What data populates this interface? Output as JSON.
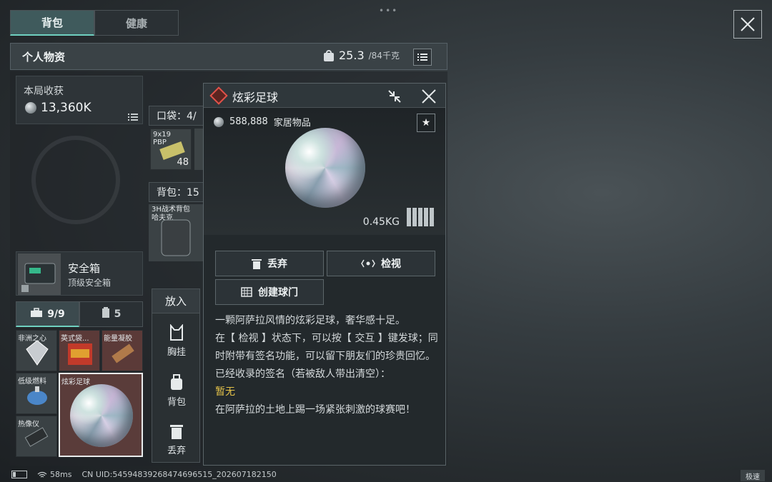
{
  "tabs": [
    "背包",
    "健康"
  ],
  "header": {
    "title": "个人物资",
    "weight_current": "25.3",
    "weight_max": "/84千克"
  },
  "income": {
    "label": "本局收获",
    "value": "13,360K"
  },
  "safebox": {
    "title": "安全箱",
    "subtitle": "顶级安全箱"
  },
  "container_tabs": {
    "a": "9/9",
    "b": "5"
  },
  "grid_items": [
    "非洲之心",
    "英式袋...",
    "能量凝胶",
    "低级燃料",
    "炫彩足球",
    "热像仪"
  ],
  "pocket": {
    "label": "口袋：4/"
  },
  "ammo": {
    "name": "9x19\nPBP",
    "count": "48"
  },
  "backpack": {
    "label": "背包：15",
    "item": "3H战术背包\n哈夫克"
  },
  "actions": {
    "header": "放入",
    "items": [
      "胸挂",
      "背包",
      "丢弃"
    ]
  },
  "card": {
    "title": "炫彩足球",
    "price": "588,888",
    "category": "家居物品",
    "weight": "0.45KG",
    "buttons": {
      "discard": "丢弃",
      "inspect": "检视",
      "create_goal": "创建球门"
    },
    "description": [
      "一颗阿萨拉风情的炫彩足球，奢华感十足。",
      "在【 检视 】状态下，可以按【 交互 】键发球；同时附带有签名功能，可以留下朋友们的珍贵回忆。",
      "已经收录的签名（若被敌人带出清空）："
    ],
    "signature": "暂无",
    "closing": "在阿萨拉的土地上踢一场紧张刺激的球赛吧！"
  },
  "status": {
    "ping": "58ms",
    "uid": "CN UID:54594839268474696515_202607182150",
    "speed": "极速"
  },
  "colors": {
    "accent": "#6fd0c0",
    "highlight": "#e5c34a",
    "rarity_red": "#e0524a"
  }
}
